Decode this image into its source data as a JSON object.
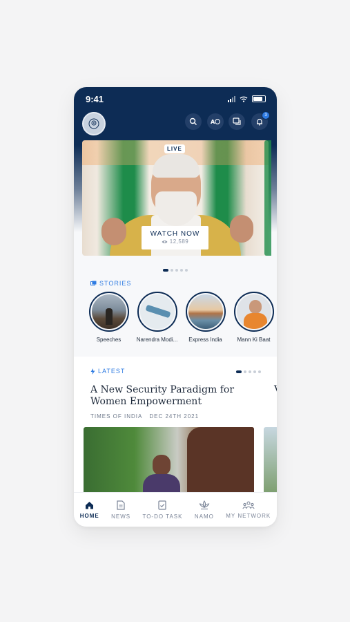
{
  "status": {
    "time": "9:41"
  },
  "header": {
    "icons": [
      "search-icon",
      "language-translate-icon",
      "messages-icon",
      "bell-icon"
    ],
    "notification_count": "3"
  },
  "hero": {
    "live_label": "LIVE",
    "watch_label": "WATCH NOW",
    "views": "12,589",
    "page_indicator": {
      "count": 5,
      "active": 0
    }
  },
  "stories": {
    "section_label": "STORIES",
    "items": [
      {
        "label": "Speeches"
      },
      {
        "label": "Narendra Modi..."
      },
      {
        "label": "Express India"
      },
      {
        "label": "Mann Ki Baat"
      }
    ]
  },
  "latest": {
    "section_label": "LATEST",
    "article": {
      "title": "A New Security Paradigm for Women Empowerment",
      "source": "TIMES OF INDIA",
      "date": "DEC 24TH 2021"
    },
    "page_indicator": {
      "count": 5,
      "active": 0
    }
  },
  "tabs": [
    {
      "label": "HOME",
      "icon": "home-icon",
      "active": true
    },
    {
      "label": "NEWS",
      "icon": "news-icon",
      "active": false
    },
    {
      "label": "TO-DO TASK",
      "icon": "todo-icon",
      "active": false
    },
    {
      "label": "NAMO",
      "icon": "lotus-icon",
      "active": false
    },
    {
      "label": "MY NETWORK",
      "icon": "network-icon",
      "active": false
    }
  ],
  "colors": {
    "brand_navy": "#0d2c55",
    "accent_blue": "#2e7be2",
    "background": "#f4f4f5"
  }
}
